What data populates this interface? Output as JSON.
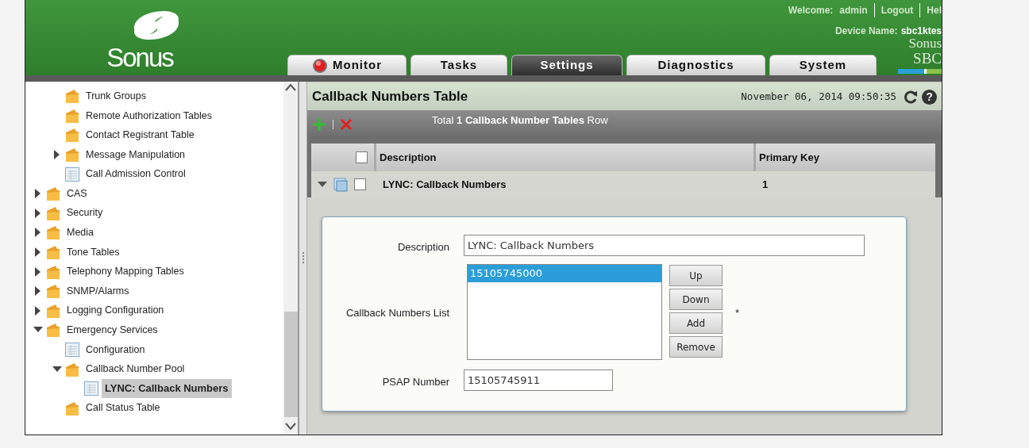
{
  "header": {
    "brand": "Sonus",
    "welcome_label": "Welcome:",
    "user": "admin",
    "logout": "Logout",
    "help": "Hel",
    "device_label": "Device Name:",
    "device_name": "sbc1ktes",
    "product_lines": [
      "Sonus",
      "SBC"
    ]
  },
  "tabs": [
    {
      "label": "Monitor",
      "selected": false,
      "kind": "status"
    },
    {
      "label": "Tasks",
      "selected": false,
      "kind": "plain"
    },
    {
      "label": "Settings",
      "selected": true,
      "kind": "plain"
    },
    {
      "label": "Diagnostics",
      "selected": false,
      "kind": "plain"
    },
    {
      "label": "System",
      "selected": false,
      "kind": "plain"
    }
  ],
  "tree": [
    {
      "children": [
        {
          "label": "Trunk Groups",
          "kind": "folder",
          "selected": false
        },
        {
          "label": "Remote Authorization Tables",
          "kind": "folder",
          "selected": false
        },
        {
          "label": "Contact Registrant Table",
          "kind": "folder",
          "selected": false
        },
        {
          "label": "Message Manipulation",
          "kind": "folder",
          "expanded": false,
          "selected": false
        },
        {
          "label": "Call Admission Control",
          "kind": "table",
          "selected": false
        }
      ]
    },
    {
      "label": "CAS",
      "kind": "folder",
      "expanded": false,
      "selected": false
    },
    {
      "label": "Security",
      "kind": "folder",
      "expanded": false,
      "selected": false
    },
    {
      "label": "Media",
      "kind": "folder",
      "expanded": false,
      "selected": false
    },
    {
      "label": "Tone Tables",
      "kind": "folder",
      "expanded": false,
      "selected": false
    },
    {
      "label": "Telephony Mapping Tables",
      "kind": "folder",
      "expanded": false,
      "selected": false
    },
    {
      "label": "SNMP/Alarms",
      "kind": "folder",
      "expanded": false,
      "selected": false
    },
    {
      "label": "Logging Configuration",
      "kind": "folder",
      "expanded": false,
      "selected": false
    },
    {
      "label": "Emergency Services",
      "kind": "folder",
      "expanded": true,
      "selected": false,
      "children": [
        {
          "label": "Configuration",
          "kind": "table",
          "selected": false
        },
        {
          "label": "Callback Number Pool",
          "kind": "folder",
          "expanded": true,
          "selected": false,
          "children": [
            {
              "label": "LYNC: Callback Numbers",
              "kind": "table",
              "selected": true
            }
          ]
        },
        {
          "label": "Call Status Table",
          "kind": "folder",
          "selected": false
        }
      ]
    }
  ],
  "panel": {
    "title": "Callback Numbers Table",
    "timestamp": "November 06, 2014 09:50:35",
    "help_glyph": "?",
    "summary": "Total **1 Callback Number Tables** Row",
    "table": {
      "columns": [
        "Description",
        "Primary Key"
      ],
      "header_checked": false,
      "rows": [
        {
          "expanded": true,
          "checked": false,
          "cells": [
            "LYNC: Callback Numbers",
            "1"
          ]
        }
      ]
    },
    "form": {
      "fields": [
        {
          "kind": "text",
          "label": "Description",
          "value": "LYNC: Callback Numbers"
        },
        {
          "kind": "list",
          "label": "Callback Numbers List",
          "items": [
            {
              "text": "15105745000",
              "selected": true
            }
          ],
          "buttons": [
            "Up",
            "Down",
            "Add",
            "Remove"
          ],
          "required_mark": "*"
        },
        {
          "kind": "text",
          "label": "PSAP Number",
          "value": "15105745911"
        }
      ]
    }
  }
}
